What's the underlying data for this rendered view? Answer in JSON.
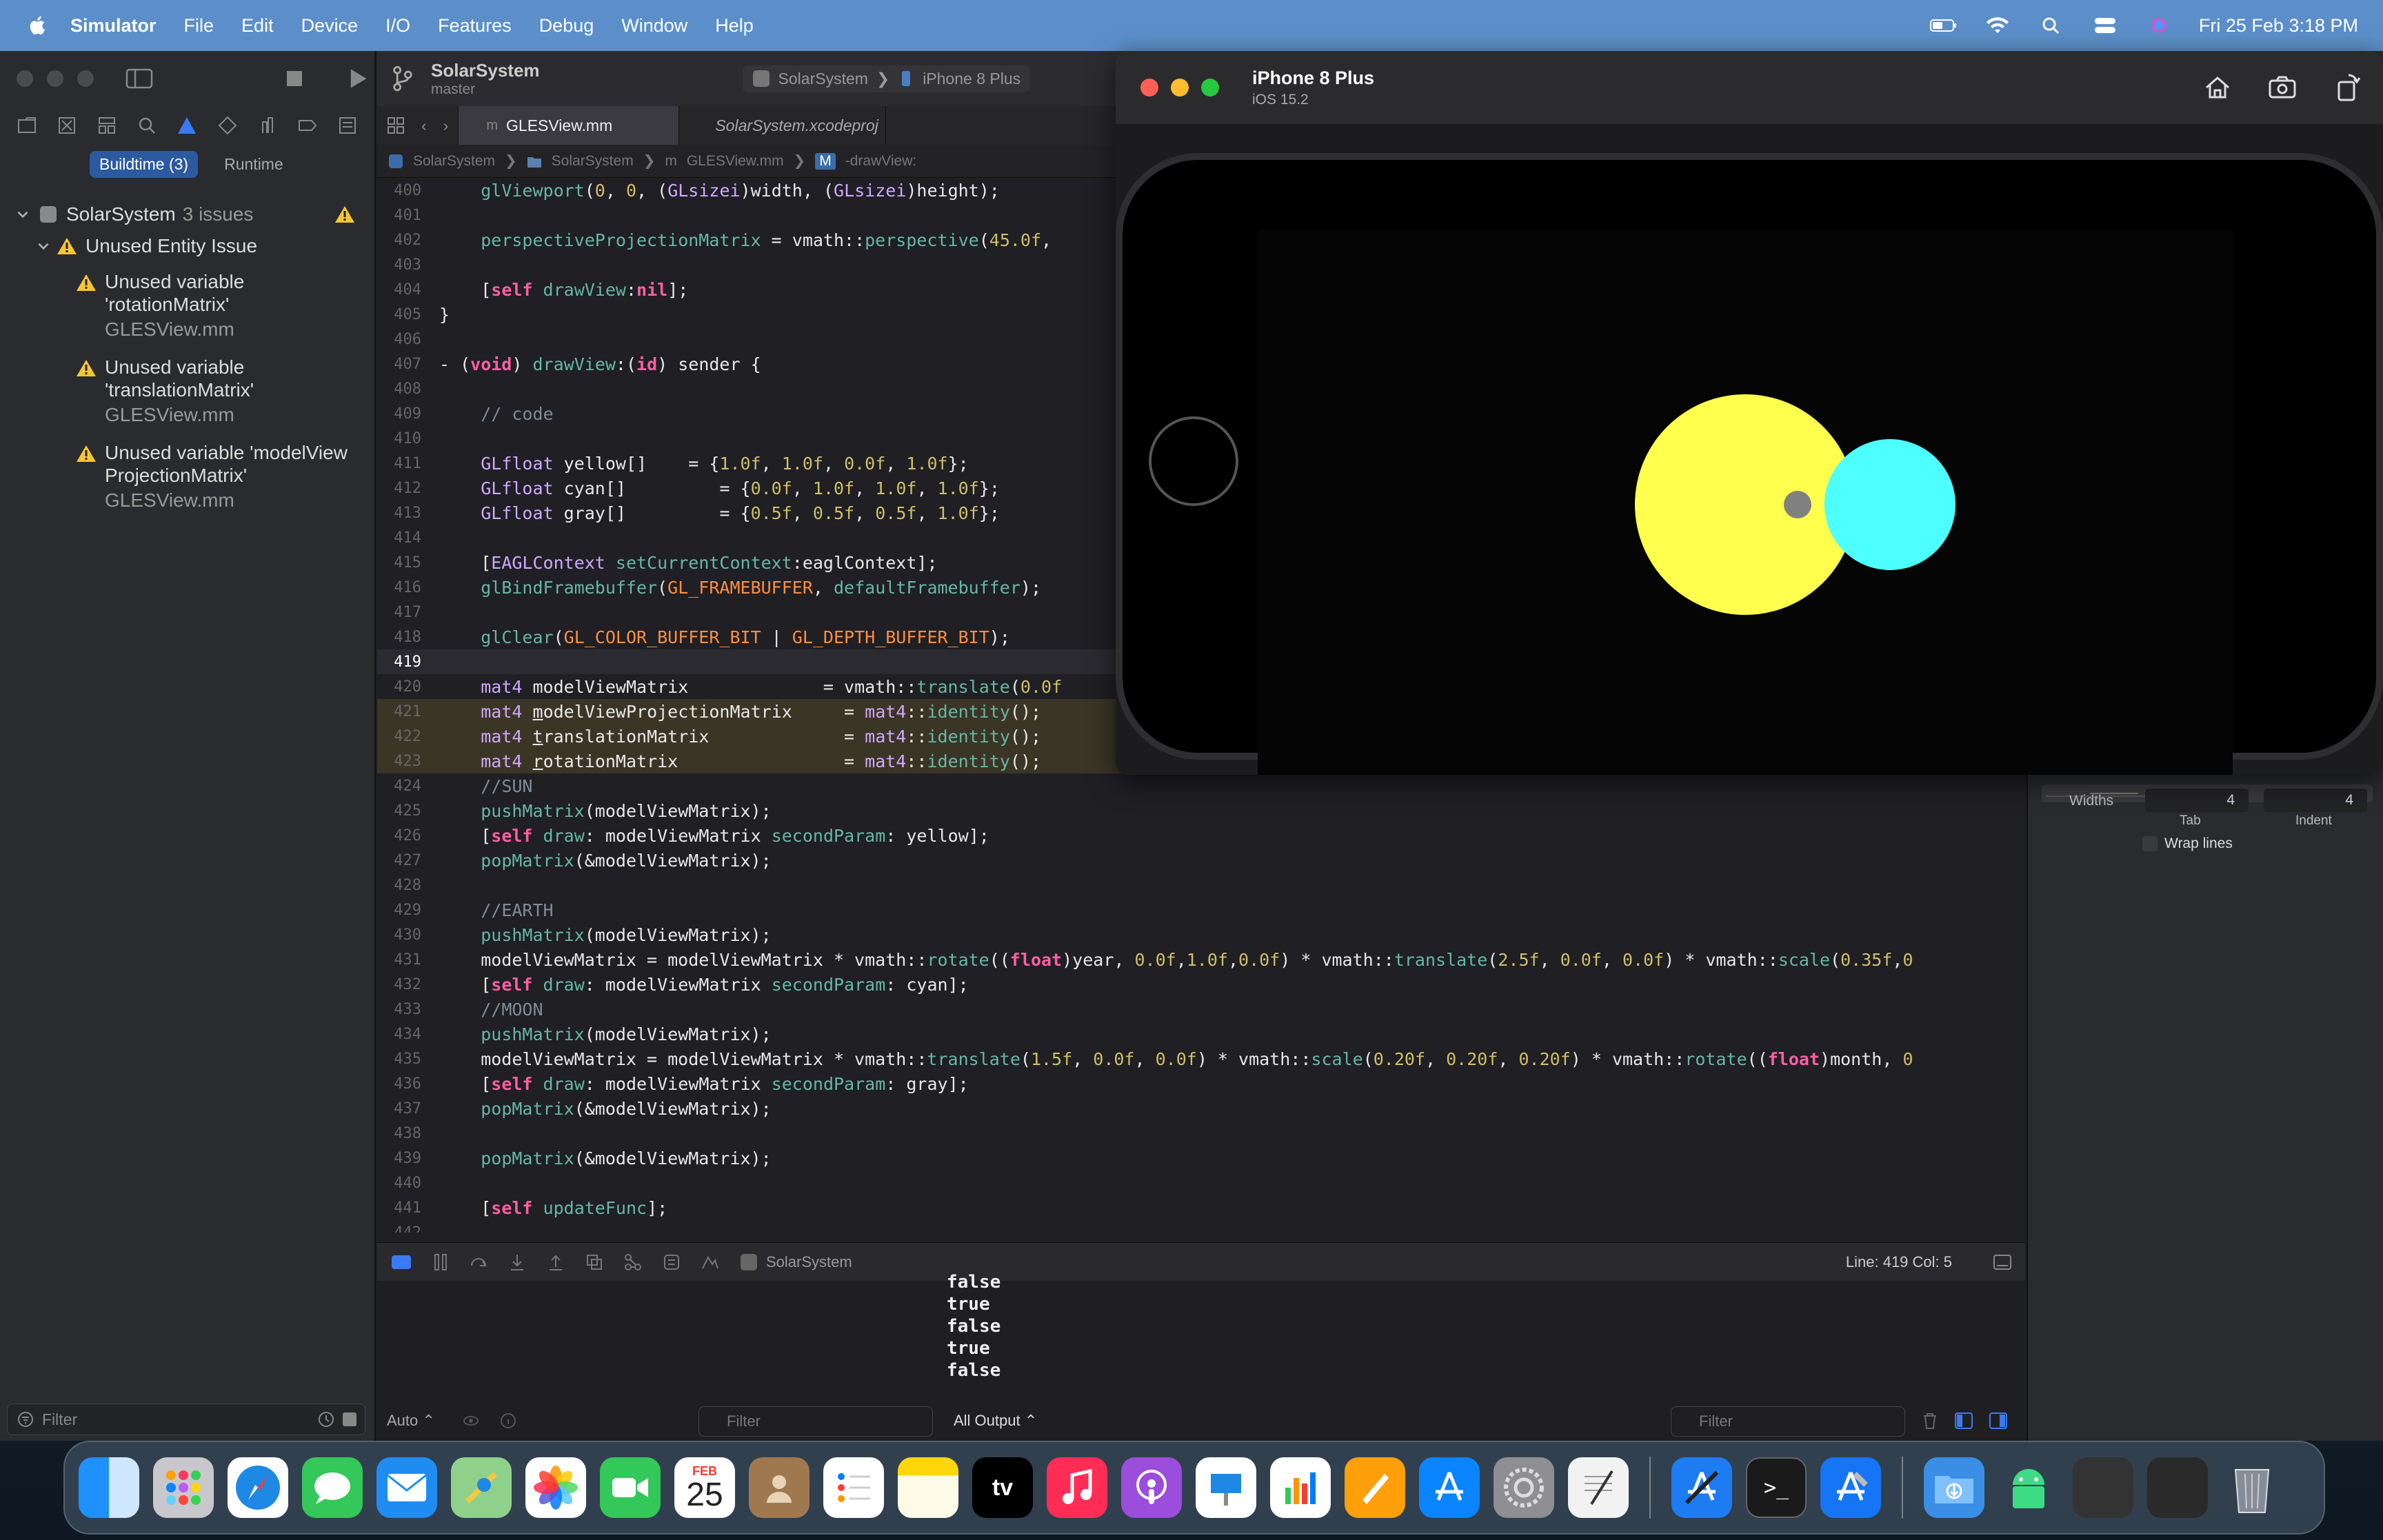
{
  "menubar": {
    "app_name": "Simulator",
    "items": [
      "File",
      "Edit",
      "Device",
      "I/O",
      "Features",
      "Debug",
      "Window",
      "Help"
    ],
    "datetime": "Fri 25 Feb  3:18 PM"
  },
  "xcode": {
    "project_name": "SolarSystem",
    "branch": "master",
    "scheme": "SolarSystem",
    "destination": "iPhone 8 Plus",
    "navigator": {
      "seg_buildtime": "Buildtime (3)",
      "seg_runtime": "Runtime",
      "project": "SolarSystem",
      "issue_count": "3 issues",
      "group": "Unused Entity Issue",
      "issues": [
        {
          "title": "Unused variable 'rotationMatrix'",
          "file": "GLESView.mm"
        },
        {
          "title": "Unused variable 'translationMatrix'",
          "file": "GLESView.mm"
        },
        {
          "title": "Unused variable 'modelViewProjectionMatrix'",
          "file": "GLESView.mm"
        }
      ],
      "filter_placeholder": "Filter"
    },
    "tabs": [
      "GLESView.mm",
      "SolarSystem.xcodeproj"
    ],
    "jumpbar": [
      "SolarSystem",
      "SolarSystem",
      "GLESView.mm",
      "-drawView:"
    ],
    "code_lines": [
      {
        "n": "400",
        "html": "    <span class='fn'>glViewport</span>(<span class='num'>0</span>, <span class='num'>0</span>, (<span class='ty'>GLsizei</span>)width, (<span class='ty'>GLsizei</span>)height);"
      },
      {
        "n": "401",
        "html": ""
      },
      {
        "n": "402",
        "html": "    <span class='fn'>perspectiveProjectionMatrix</span> = vmath::<span class='fn'>perspective</span>(<span class='num'>45.0f</span>,"
      },
      {
        "n": "403",
        "html": ""
      },
      {
        "n": "404",
        "html": "    [<span class='kw'>self</span> <span class='fn'>drawView</span>:<span class='kw'>nil</span>];"
      },
      {
        "n": "405",
        "html": "}"
      },
      {
        "n": "406",
        "html": ""
      },
      {
        "n": "407",
        "html": "- (<span class='kw'>void</span>) <span class='fn'>drawView</span>:(<span class='kw'>id</span>) sender {"
      },
      {
        "n": "408",
        "html": ""
      },
      {
        "n": "409",
        "html": "    <span class='cm'>// code</span>"
      },
      {
        "n": "410",
        "html": ""
      },
      {
        "n": "411",
        "html": "    <span class='ty'>GLfloat</span> yellow[]    = {<span class='num'>1.0f</span>, <span class='num'>1.0f</span>, <span class='num'>0.0f</span>, <span class='num'>1.0f</span>};"
      },
      {
        "n": "412",
        "html": "    <span class='ty'>GLfloat</span> cyan[]         = {<span class='num'>0.0f</span>, <span class='num'>1.0f</span>, <span class='num'>1.0f</span>, <span class='num'>1.0f</span>};"
      },
      {
        "n": "413",
        "html": "    <span class='ty'>GLfloat</span> gray[]         = {<span class='num'>0.5f</span>, <span class='num'>0.5f</span>, <span class='num'>0.5f</span>, <span class='num'>1.0f</span>};"
      },
      {
        "n": "414",
        "html": ""
      },
      {
        "n": "415",
        "html": "    [<span class='ty'>EAGLContext</span> <span class='fn'>setCurrentContext</span>:eaglContext];"
      },
      {
        "n": "416",
        "html": "    <span class='fn'>glBindFramebuffer</span>(<span class='mac'>GL_FRAMEBUFFER</span>, <span class='fn'>defaultFramebuffer</span>);"
      },
      {
        "n": "417",
        "html": ""
      },
      {
        "n": "418",
        "html": "    <span class='fn'>glClear</span>(<span class='mac'>GL_COLOR_BUFFER_BIT</span> | <span class='mac'>GL_DEPTH_BUFFER_BIT</span>);"
      },
      {
        "n": "419",
        "html": "",
        "cur": true
      },
      {
        "n": "420",
        "html": "    <span class='ty'>mat4</span> modelViewMatrix             = vmath::<span class='fn'>translate</span>(<span class='num'>0.0f</span>"
      },
      {
        "n": "421",
        "html": "    <span class='ty'>mat4</span> <u>m</u>odelViewProjectionMatrix     = <span class='ty'>mat4</span>::<span class='fn'>identity</span>();",
        "hl": true
      },
      {
        "n": "422",
        "html": "    <span class='ty'>mat4</span> <u>t</u>ranslationMatrix             = <span class='ty'>mat4</span>::<span class='fn'>identity</span>();",
        "hl": true
      },
      {
        "n": "423",
        "html": "    <span class='ty'>mat4</span> <u>r</u>otationMatrix                = <span class='ty'>mat4</span>::<span class='fn'>identity</span>();",
        "hl": true
      },
      {
        "n": "424",
        "html": "    <span class='cm'>//SUN</span>"
      },
      {
        "n": "425",
        "html": "    <span class='fn'>pushMatrix</span>(modelViewMatrix);"
      },
      {
        "n": "426",
        "html": "    [<span class='kw'>self</span> <span class='fn'>draw</span>: modelViewMatrix <span class='fn'>secondParam</span>: yellow];"
      },
      {
        "n": "427",
        "html": "    <span class='fn'>popMatrix</span>(&amp;modelViewMatrix);"
      },
      {
        "n": "428",
        "html": ""
      },
      {
        "n": "429",
        "html": "    <span class='cm'>//EARTH</span>"
      },
      {
        "n": "430",
        "html": "    <span class='fn'>pushMatrix</span>(modelViewMatrix);"
      },
      {
        "n": "431",
        "html": "    modelViewMatrix = modelViewMatrix * vmath::<span class='fn'>rotate</span>((<span class='kw'>float</span>)year, <span class='num'>0.0f</span>,<span class='num'>1.0f</span>,<span class='num'>0.0f</span>) * vmath::<span class='fn'>translate</span>(<span class='num'>2.5f</span>, <span class='num'>0.0f</span>, <span class='num'>0.0f</span>) * vmath::<span class='fn'>scale</span>(<span class='num'>0.35f</span>,<span class='num'>0</span>"
      },
      {
        "n": "432",
        "html": "    [<span class='kw'>self</span> <span class='fn'>draw</span>: modelViewMatrix <span class='fn'>secondParam</span>: cyan];"
      },
      {
        "n": "433",
        "html": "    <span class='cm'>//MOON</span>"
      },
      {
        "n": "434",
        "html": "    <span class='fn'>pushMatrix</span>(modelViewMatrix);"
      },
      {
        "n": "435",
        "html": "    modelViewMatrix = modelViewMatrix * vmath::<span class='fn'>translate</span>(<span class='num'>1.5f</span>, <span class='num'>0.0f</span>, <span class='num'>0.0f</span>) * vmath::<span class='fn'>scale</span>(<span class='num'>0.20f</span>, <span class='num'>0.20f</span>, <span class='num'>0.20f</span>) * vmath::<span class='fn'>rotate</span>((<span class='kw'>float</span>)month, <span class='num'>0</span>"
      },
      {
        "n": "436",
        "html": "    [<span class='kw'>self</span> <span class='fn'>draw</span>: modelViewMatrix <span class='fn'>secondParam</span>: gray];"
      },
      {
        "n": "437",
        "html": "    <span class='fn'>popMatrix</span>(&amp;modelViewMatrix);"
      },
      {
        "n": "438",
        "html": ""
      },
      {
        "n": "439",
        "html": "    <span class='fn'>popMatrix</span>(&amp;modelViewMatrix);"
      },
      {
        "n": "440",
        "html": ""
      },
      {
        "n": "441",
        "html": "    [<span class='kw'>self</span> <span class='fn'>updateFunc</span>];"
      },
      {
        "n": "442",
        "html": ""
      }
    ],
    "debugbar": {
      "target": "SolarSystem",
      "line_col": "Line: 419  Col: 5"
    },
    "console": {
      "output": [
        "false",
        "true",
        "false",
        "true",
        "false"
      ],
      "auto_label": "Auto ⌃",
      "filter_placeholder": "Filter",
      "output_selector": "All Output ⌃"
    },
    "inspector": {
      "widths_label": "Widths",
      "tab_value": "4",
      "indent_value": "4",
      "tab_label": "Tab",
      "indent_label": "Indent",
      "wrap_label": "Wrap lines"
    }
  },
  "simulator": {
    "device_name": "iPhone 8 Plus",
    "os_version": "iOS 15.2",
    "scene": {
      "sun_color": "#ffff4d",
      "earth_color": "#4dffff",
      "moon_color": "#808080"
    }
  },
  "dock": {
    "date_month": "FEB",
    "date_day": "25",
    "tv_label": "tv"
  }
}
